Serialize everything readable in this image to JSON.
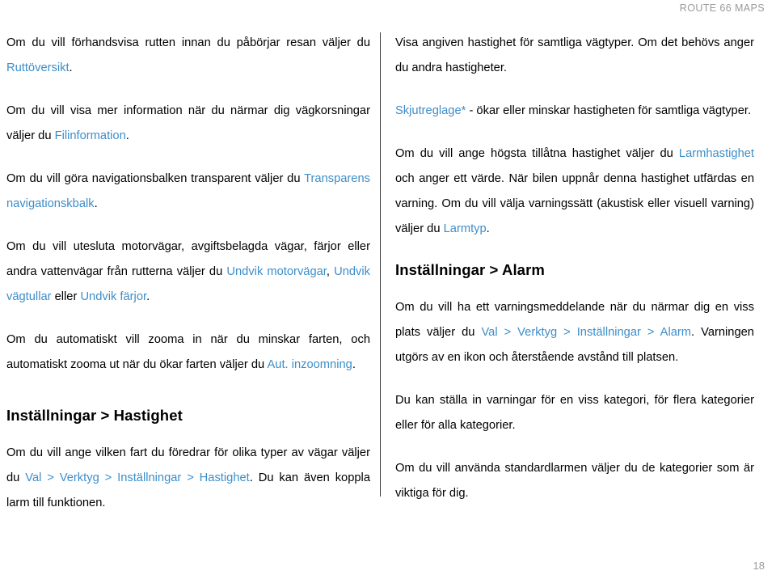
{
  "header": {
    "running_title": "ROUTE 66 MAPS"
  },
  "footer": {
    "page_number": "18"
  },
  "colors": {
    "link": "#3d8ec9",
    "text": "#000000",
    "muted": "#9a9a9a",
    "divider": "#3a3a3a"
  },
  "left_column": {
    "paragraphs": [
      {
        "id": "route-preview",
        "parts": [
          {
            "type": "text",
            "value": "Om du vill förhandsvisa rutten innan du påbörjar resan väljer du "
          },
          {
            "type": "link",
            "value": "Ruttöversikt"
          },
          {
            "type": "text",
            "value": "."
          }
        ]
      },
      {
        "id": "junction-info",
        "parts": [
          {
            "type": "text",
            "value": "Om du vill visa mer information när du närmar dig vägkorsningar väljer du "
          },
          {
            "type": "link",
            "value": "Filinformation"
          },
          {
            "type": "text",
            "value": "."
          }
        ]
      },
      {
        "id": "transparent-navbar",
        "parts": [
          {
            "type": "text",
            "value": "Om du vill göra navigationsbalken transparent väljer du "
          },
          {
            "type": "link",
            "value": "Transparens navigationskbalk"
          },
          {
            "type": "text",
            "value": "."
          }
        ]
      },
      {
        "id": "avoid-roads",
        "parts": [
          {
            "type": "text",
            "value": "Om du vill utesluta motorvägar, avgiftsbelagda vägar, färjor eller andra vattenvägar från rutterna väljer du "
          },
          {
            "type": "link",
            "value": "Undvik motorvägar"
          },
          {
            "type": "text",
            "value": ", "
          },
          {
            "type": "link",
            "value": "Undvik vägtullar"
          },
          {
            "type": "text",
            "value": " eller "
          },
          {
            "type": "link",
            "value": "Undvik färjor"
          },
          {
            "type": "text",
            "value": "."
          }
        ]
      },
      {
        "id": "auto-zoom",
        "parts": [
          {
            "type": "text",
            "value": "Om du automatiskt vill zooma in när du minskar farten, och automatiskt zooma ut när du ökar farten väljer du "
          },
          {
            "type": "link",
            "value": "Aut. inzoomning"
          },
          {
            "type": "text",
            "value": "."
          }
        ]
      }
    ],
    "heading": "Inställningar > Hastighet",
    "after_heading_paragraphs": [
      {
        "id": "speed-settings",
        "parts": [
          {
            "type": "text",
            "value": "Om du vill ange vilken fart du föredrar för olika typer av vägar väljer du "
          },
          {
            "type": "link",
            "value": "Val > Verktyg > Inställningar > Hastighet"
          },
          {
            "type": "text",
            "value": ". Du kan även koppla larm till funktionen."
          }
        ]
      }
    ]
  },
  "right_column": {
    "paragraphs": [
      {
        "id": "show-speed",
        "parts": [
          {
            "type": "text",
            "value": "Visa angiven hastighet för samtliga vägtyper. Om det behövs anger du andra hastigheter."
          }
        ]
      },
      {
        "id": "slider",
        "parts": [
          {
            "type": "link",
            "value": "Skjutreglage*"
          },
          {
            "type": "text",
            "value": " - ökar eller minskar hastigheten för samtliga vägtyper."
          }
        ]
      },
      {
        "id": "alarm-speed",
        "parts": [
          {
            "type": "text",
            "value": "Om du vill ange högsta tillåtna hastighet väljer du "
          },
          {
            "type": "link",
            "value": "Larmhastighet"
          },
          {
            "type": "text",
            "value": " och anger ett värde. När bilen uppnår denna hastighet utfärdas en varning. Om du vill välja varningssätt (akustisk eller visuell varning) väljer du "
          },
          {
            "type": "link",
            "value": "Larmtyp"
          },
          {
            "type": "text",
            "value": "."
          }
        ]
      }
    ],
    "heading": "Inställningar > Alarm",
    "after_heading_paragraphs": [
      {
        "id": "alarm-settings",
        "parts": [
          {
            "type": "text",
            "value": "Om du vill ha ett varningsmeddelande när du närmar dig en viss plats väljer du "
          },
          {
            "type": "link",
            "value": "Val > Verktyg > Inställningar > Alarm"
          },
          {
            "type": "text",
            "value": ". Varningen utgörs av en ikon och återstående avstånd till platsen."
          }
        ]
      },
      {
        "id": "alarm-categories",
        "parts": [
          {
            "type": "text",
            "value": "Du kan ställa in varningar för en viss kategori, för flera kategorier eller för alla kategorier."
          }
        ]
      },
      {
        "id": "default-alarms",
        "parts": [
          {
            "type": "text",
            "value": "Om du vill använda standardlarmen väljer du de kategorier som är viktiga för dig."
          }
        ]
      }
    ]
  }
}
